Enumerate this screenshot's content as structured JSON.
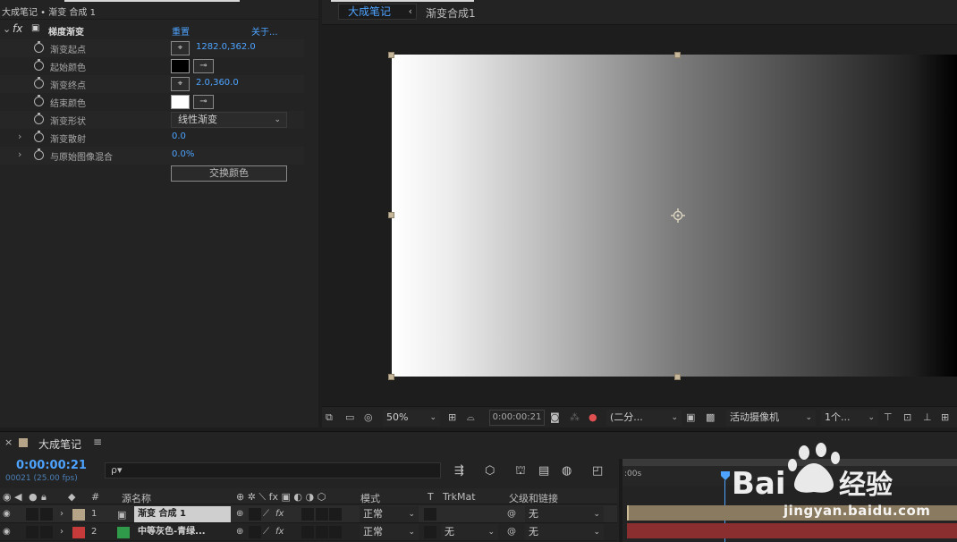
{
  "effects_panel": {
    "tab_title": "大成笔记 • 渐变 合成 1",
    "effect_name": "梯度渐变",
    "reset": "重置",
    "about": "关于...",
    "properties": [
      {
        "label": "渐变起点",
        "value": "1282.0,362.0"
      },
      {
        "label": "起始颜色",
        "color": "#000000"
      },
      {
        "label": "渐变终点",
        "value": "2.0,360.0"
      },
      {
        "label": "结束颜色",
        "color": "#ffffff"
      },
      {
        "label": "渐变形状",
        "value": "线性渐变"
      },
      {
        "label": "渐变散射",
        "value": "0.0"
      },
      {
        "label": "与原始图像混合",
        "value": "0.0%"
      }
    ],
    "swap_colors": "交换颜色"
  },
  "viewer": {
    "tabs": [
      {
        "label": "大成笔记"
      },
      {
        "label": "渐变合成1"
      }
    ],
    "toolbar": {
      "zoom": "50%",
      "timecode": "0:00:00:21",
      "resolution": "(二分...",
      "camera": "活动摄像机",
      "views": "1个..."
    }
  },
  "timeline": {
    "comp_name": "大成笔记",
    "current_time": "0:00:00:21",
    "frame_info": "00021 (25.00 fps)",
    "search_placeholder": "",
    "search_icon": "ρ▾",
    "ruler_start": ":00s",
    "columns": {
      "hash": "#",
      "source_name": "源名称",
      "mode": "模式",
      "t": "T",
      "trkmat": "TrkMat",
      "parent": "父级和链接"
    },
    "layers": [
      {
        "index": "1",
        "name": "渐变 合成 1",
        "label_color": "#b5a487",
        "mode": "正常",
        "trkmat": "",
        "parent": "无",
        "selected": true
      },
      {
        "index": "2",
        "name": "中等灰色-青绿...",
        "label_color": "#2f9a4a",
        "mode": "正常",
        "trkmat": "无",
        "parent": "无",
        "selected": false
      }
    ]
  },
  "watermark": {
    "brand": "Baidu经验",
    "url": "jingyan.baidu.com"
  },
  "colors": {
    "accent": "#4da3ff",
    "panel": "#232323",
    "layer1_bar": "#8a7a5f",
    "layer2_bar": "#8a2e30"
  }
}
